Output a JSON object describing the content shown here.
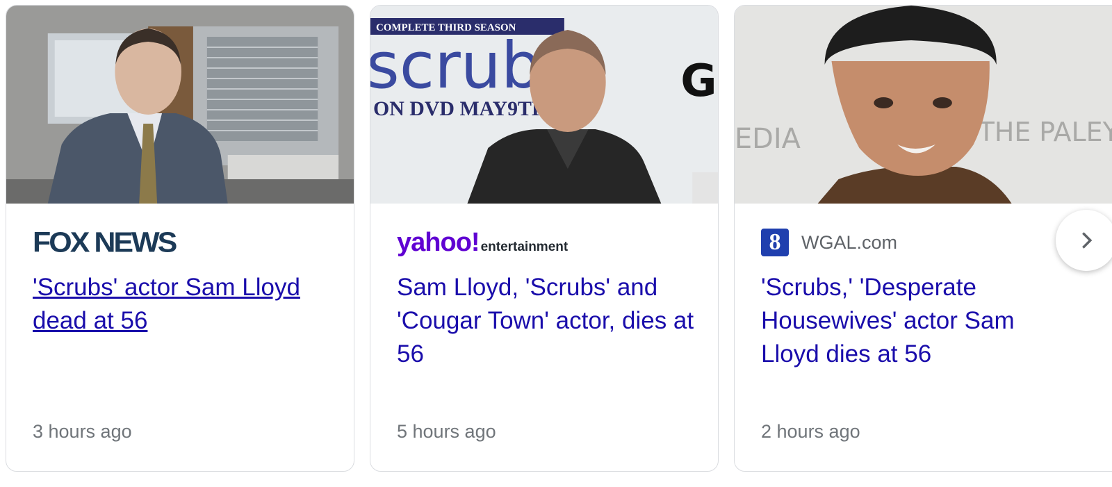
{
  "cards": [
    {
      "source": "FOX NEWS",
      "headline": "'Scrubs' actor Sam Lloyd dead at 56",
      "time": "3 hours ago"
    },
    {
      "source": "yahoo!",
      "source_sub": "entertainment",
      "headline": "Sam Lloyd, 'Scrubs' and 'Cougar Town' actor, dies at 56",
      "time": "5 hours ago",
      "image_text": {
        "banner": "COMPLETE THIRD SEASON",
        "title": "scrubs",
        "date": "ON DVD MAY9TH"
      }
    },
    {
      "badge": "8",
      "source": "WGAL.com",
      "headline": "'Scrubs,' 'Desperate Housewives' actor Sam Lloyd dies at 56",
      "time": "2 hours ago",
      "image_text": {
        "left": "EDIA",
        "right": "THE PALEY"
      }
    }
  ],
  "next_button": {
    "icon": "chevron-right-icon"
  },
  "colors": {
    "link": "#1a0dab",
    "time": "#70757a",
    "fox": "#1c3a57",
    "yahoo": "#6001d2",
    "wgal": "#1f3fae"
  }
}
